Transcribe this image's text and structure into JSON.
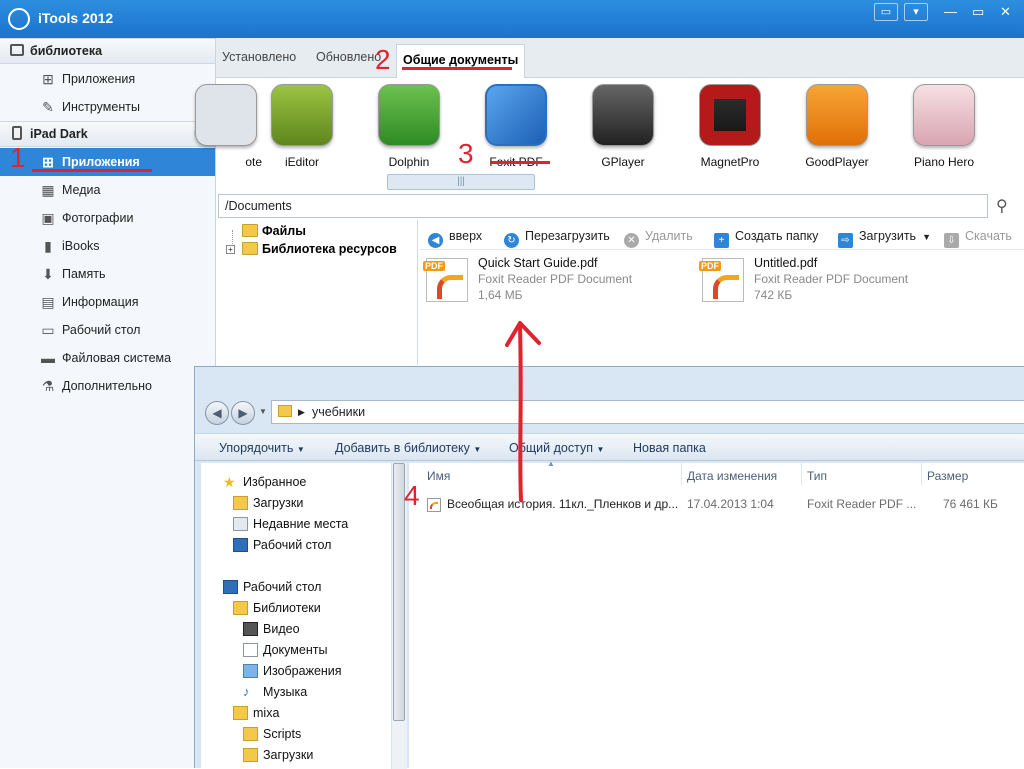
{
  "app": {
    "title": "iTools 2012"
  },
  "sidebar": {
    "library_header": "библиотека",
    "library_items": [
      {
        "label": "Приложения",
        "icon": "grid-icon"
      },
      {
        "label": "Инструменты",
        "icon": "wrench-icon"
      }
    ],
    "device_header": "iPad Dark",
    "device_items": [
      {
        "label": "Приложения",
        "icon": "grid-icon",
        "selected": true
      },
      {
        "label": "Медиа",
        "icon": "film-icon"
      },
      {
        "label": "Фотографии",
        "icon": "photo-icon"
      },
      {
        "label": "iBooks",
        "icon": "book-icon"
      },
      {
        "label": "Память",
        "icon": "storage-icon"
      },
      {
        "label": "Информация",
        "icon": "info-icon"
      },
      {
        "label": "Рабочий стол",
        "icon": "desktop-icon"
      },
      {
        "label": "Файловая система",
        "icon": "folder-icon"
      },
      {
        "label": "Дополнительно",
        "icon": "flask-icon"
      }
    ]
  },
  "tabs": [
    {
      "label": "Установлено"
    },
    {
      "label": "Обновлено"
    },
    {
      "label": "Общие документы",
      "active": true
    }
  ],
  "apps": [
    {
      "label": "ote",
      "color": "#dfe4ea"
    },
    {
      "label": "iEditor",
      "color": "#7ea12c"
    },
    {
      "label": "Dolphin",
      "color": "#4aa035"
    },
    {
      "label": "Foxit PDF",
      "color": "#3d82d2"
    },
    {
      "label": "GPlayer",
      "color": "#333333"
    },
    {
      "label": "MagnetPro",
      "color": "#b41a1a"
    },
    {
      "label": "GoodPlayer",
      "color": "#f08a12"
    },
    {
      "label": "Piano Hero",
      "color": "#f3d7dd"
    }
  ],
  "path": "/Documents",
  "tree": [
    {
      "label": "Файлы"
    },
    {
      "label": "Библиотека ресурсов"
    }
  ],
  "file_toolbar": [
    {
      "label": "вверх",
      "icon": "up-arrow-icon",
      "enabled": true
    },
    {
      "label": "Перезагрузить",
      "icon": "refresh-icon",
      "enabled": true
    },
    {
      "label": "Удалить",
      "icon": "delete-icon",
      "enabled": false
    },
    {
      "label": "Создать папку",
      "icon": "new-folder-icon",
      "enabled": true
    },
    {
      "label": "Загрузить",
      "icon": "upload-icon",
      "enabled": true
    },
    {
      "label": "Скачать",
      "icon": "download-icon",
      "enabled": false
    }
  ],
  "documents": [
    {
      "name": "Quick Start Guide.pdf",
      "type": "Foxit Reader PDF Document",
      "size": "1,64 МБ"
    },
    {
      "name": "Untitled.pdf",
      "type": "Foxit Reader PDF Document",
      "size": "742 КБ"
    }
  ],
  "explorer": {
    "breadcrumb": "учебники",
    "commands": [
      "Упорядочить",
      "Добавить в библиотеку",
      "Общий доступ",
      "Новая папка"
    ],
    "nav": [
      {
        "label": "Избранное",
        "icon": "star-icon",
        "level": 0
      },
      {
        "label": "Загрузки",
        "icon": "downloads-folder-icon",
        "level": 1
      },
      {
        "label": "Недавние места",
        "icon": "recent-places-icon",
        "level": 1
      },
      {
        "label": "Рабочий стол",
        "icon": "desktop-icon",
        "level": 1
      },
      {
        "label": "Рабочий стол",
        "icon": "desktop-icon",
        "level": 0
      },
      {
        "label": "Библиотеки",
        "icon": "libraries-icon",
        "level": 1
      },
      {
        "label": "Видео",
        "icon": "video-icon",
        "level": 2
      },
      {
        "label": "Документы",
        "icon": "documents-icon",
        "level": 2
      },
      {
        "label": "Изображения",
        "icon": "pictures-icon",
        "level": 2
      },
      {
        "label": "Музыка",
        "icon": "music-icon",
        "level": 2
      },
      {
        "label": "mixa",
        "icon": "user-folder-icon",
        "level": 1
      },
      {
        "label": "Scripts",
        "icon": "folder-icon",
        "level": 2
      },
      {
        "label": "Загрузки",
        "icon": "downloads-folder-icon",
        "level": 2
      }
    ],
    "columns": [
      "Имя",
      "Дата изменения",
      "Тип",
      "Размер"
    ],
    "file": {
      "name": "Всеобщая история. 11кл._Пленков и др...",
      "date": "17.04.2013 1:04",
      "type": "Foxit Reader PDF ...",
      "size": "76 461 КБ"
    }
  },
  "annotations": [
    "1",
    "2",
    "3",
    "4"
  ]
}
